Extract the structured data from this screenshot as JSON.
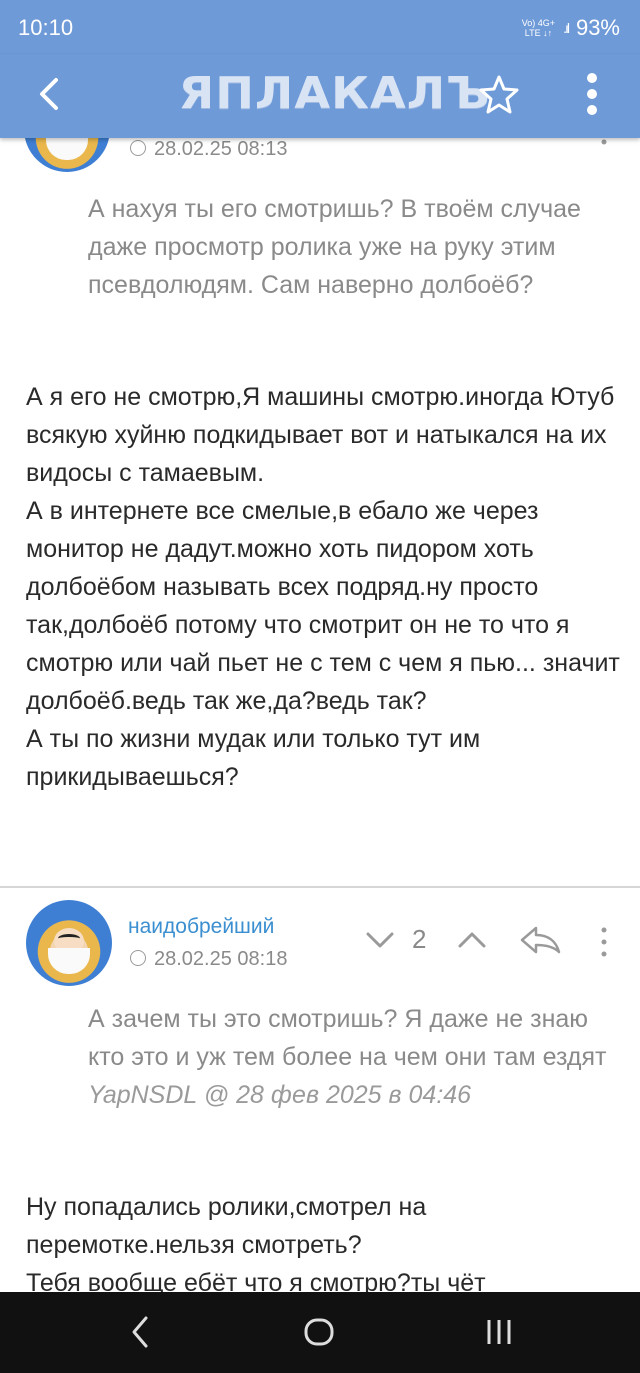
{
  "status_bar": {
    "time": "10:10",
    "network_top": "Vo) 4G+",
    "network_bottom": "LTE ↓↑",
    "signal": ".ıl",
    "battery": "93%"
  },
  "header": {
    "logo_text": "ЯПЛАКАЛЪ"
  },
  "posts": [
    {
      "date": "28.02.25 08:13",
      "quote": "А нахуя ты его смотришь? В твоём случае даже просмотр ролика уже на руку этим псевдолюдям. Сам наверно долбоёб?",
      "body": [
        "А я его не смотрю,Я машины смотрю.иногда Ютуб всякую хуйню подкидывает вот и натыкался на их видосы с тамаевым.",
        "А в интернете все смелые,в ебало же через монитор не дадут.можно хоть пидором хоть долбоёбом называть всех подряд.ну просто так,долбоёб потому что смотрит он не то что я смотрю или чай пьет не с тем с чем я пью... значит долбоёб.ведь так же,да?ведь так?",
        "А ты по жизни мудак или только тут им прикидываешься?"
      ]
    },
    {
      "username": "наидобрейший",
      "date": "28.02.25 08:18",
      "votes": "2",
      "quote": "А зачем ты это смотришь? Я даже не знаю кто это и уж тем более на чем они там ездят",
      "quote_author": "YapNSDL @ 28 фев 2025 в 04:46",
      "body": [
        "Ну попадались ролики,смотрел на перемотке.нельзя смотреть?",
        "Тебя вообще ебёт что я смотрю?ты чёт"
      ]
    }
  ],
  "colors": {
    "header": "#6f9ad8",
    "username": "#3b8fd0",
    "muted": "#8a8a8a"
  },
  "icons": [
    "back-arrow-icon",
    "star-icon",
    "more-vert-icon",
    "clock-icon",
    "vote-down-icon",
    "vote-up-icon",
    "reply-icon",
    "nav-back-icon",
    "nav-home-icon",
    "nav-recents-icon"
  ]
}
